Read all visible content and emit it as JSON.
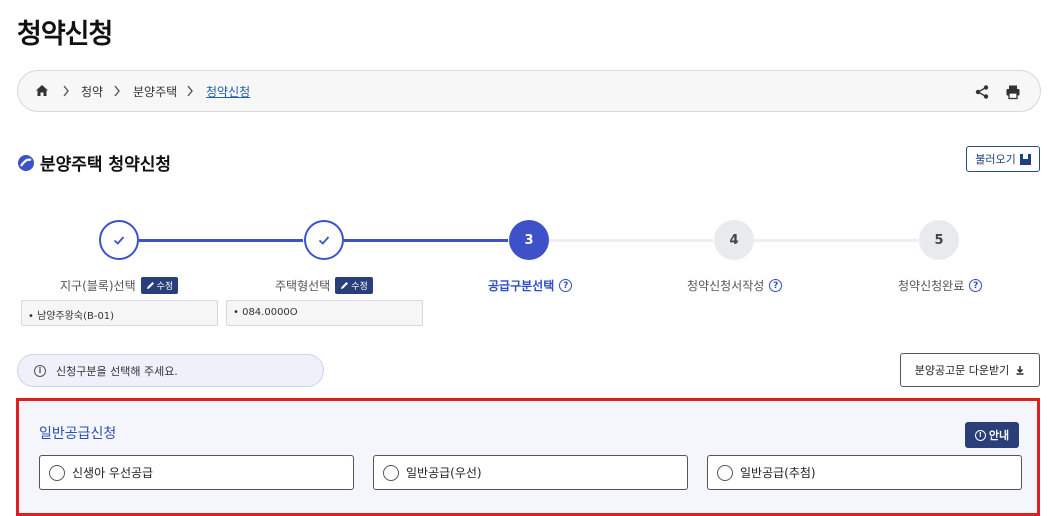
{
  "page_title": "청약신청",
  "breadcrumb": {
    "items": [
      "청약",
      "분양주택"
    ],
    "current": "청약신청"
  },
  "section": {
    "title": "분양주택 청약신청",
    "load_button": "불러오기"
  },
  "steps": [
    {
      "number": "1",
      "label": "지구(블록)선택",
      "status": "done",
      "edit_label": "수정",
      "value": "• 남양주왕숙(B-01)"
    },
    {
      "number": "2",
      "label": "주택형선택",
      "status": "done",
      "edit_label": "수정",
      "value": "• 084.0000O"
    },
    {
      "number": "3",
      "label": "공급구분선택",
      "status": "active"
    },
    {
      "number": "4",
      "label": "청약신청서작성",
      "status": "todo"
    },
    {
      "number": "5",
      "label": "청약신청완료",
      "status": "todo"
    }
  ],
  "notice": "신청구분을 선택해 주세요.",
  "download_button": "분양공고문 다운받기",
  "supply": {
    "title": "일반공급신청",
    "guide_button": "안내",
    "options": [
      "신생아 우선공급",
      "일반공급(우선)",
      "일반공급(추첨)"
    ]
  },
  "colors": {
    "primary": "#3d52c9",
    "navy": "#2a3f7a",
    "highlight_border": "#e02020"
  }
}
